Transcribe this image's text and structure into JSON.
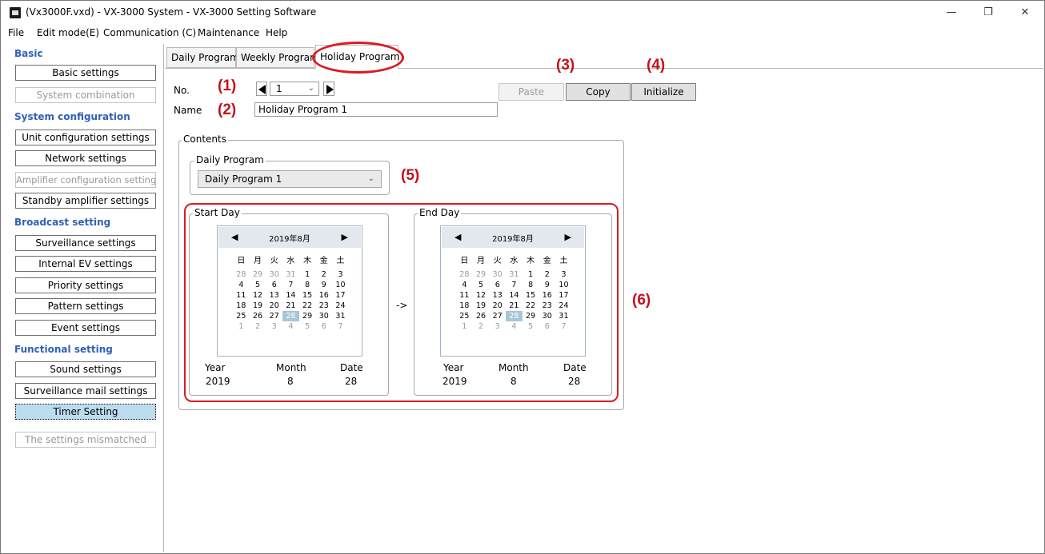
{
  "window": {
    "title": "(Vx3000F.vxd) - VX-3000 System - VX-3000 Setting Software",
    "minimize": "—",
    "maximize": "❐",
    "close": "✕"
  },
  "menu": [
    "File",
    "Edit mode(E)",
    "Communication (C)",
    "Maintenance",
    "Help"
  ],
  "sidebar": {
    "basic_heading": "Basic",
    "basic_settings": "Basic settings",
    "system_combination": "System combination",
    "system_config_heading": "System configuration",
    "unit_config": "Unit configuration settings",
    "network": "Network settings",
    "amplifier_config": "Amplifier configuration settings",
    "standby_amplifier": "Standby amplifier settings",
    "broadcast_heading": "Broadcast setting",
    "surveillance": "Surveillance settings",
    "internal_ev": "Internal EV settings",
    "priority": "Priority settings",
    "pattern": "Pattern settings",
    "event": "Event settings",
    "functional_heading": "Functional setting",
    "sound": "Sound settings",
    "surveillance_mail": "Surveillance mail settings",
    "timer": "Timer Setting",
    "mismatch": "The settings mismatched"
  },
  "tabs": [
    "Daily Program",
    "Weekly Program",
    "Holiday Program"
  ],
  "form": {
    "no_label": "No.",
    "no_value": "1",
    "name_label": "Name",
    "name_value": "Holiday Program 1"
  },
  "buttons": {
    "paste": "Paste",
    "copy": "Copy",
    "initialize": "Initialize"
  },
  "contents": {
    "title": "Contents",
    "daily_program_title": "Daily Program",
    "daily_program_value": "Daily Program 1",
    "arrow": "->"
  },
  "annotations": [
    "(1)",
    "(2)",
    "(3)",
    "(4)",
    "(5)",
    "(6)"
  ],
  "calendar_common": {
    "month_title": "2019年8月",
    "weekdays": [
      "日",
      "月",
      "火",
      "水",
      "木",
      "金",
      "土"
    ],
    "weeks": [
      [
        "28",
        "29",
        "30",
        "31",
        "1",
        "2",
        "3"
      ],
      [
        "4",
        "5",
        "6",
        "7",
        "8",
        "9",
        "10"
      ],
      [
        "11",
        "12",
        "13",
        "14",
        "15",
        "16",
        "17"
      ],
      [
        "18",
        "19",
        "20",
        "21",
        "22",
        "23",
        "24"
      ],
      [
        "25",
        "26",
        "27",
        "28",
        "29",
        "30",
        "31"
      ],
      [
        "1",
        "2",
        "3",
        "4",
        "5",
        "6",
        "7"
      ]
    ]
  },
  "start_day": {
    "title": "Start Day",
    "year_label": "Year",
    "month_label": "Month",
    "date_label": "Date",
    "year": "2019",
    "month": "8",
    "date": "28"
  },
  "end_day": {
    "title": "End Day",
    "year_label": "Year",
    "month_label": "Month",
    "date_label": "Date",
    "year": "2019",
    "month": "8",
    "date": "28"
  },
  "colors": {
    "heading_blue": "#3060b8",
    "annotation_red": "#d91b24",
    "selected_day": "#a7c6d8",
    "active_sidebar": "#bcdcf0"
  }
}
